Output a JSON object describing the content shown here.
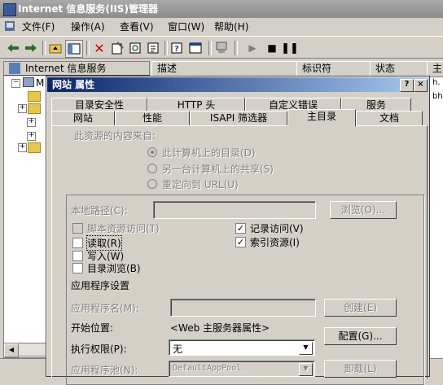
{
  "window": {
    "title": "Internet 信息服务(IIS)管理器"
  },
  "menu": {
    "items": [
      "文件(F)",
      "操作(A)",
      "查看(V)",
      "窗口(W)",
      "帮助(H)"
    ]
  },
  "tree": {
    "root_label": "Internet 信息服务",
    "node_m": "M"
  },
  "list": {
    "columns": [
      "描述",
      "标识符",
      "状态",
      "主"
    ],
    "partial_text": [
      "h.",
      "bh"
    ]
  },
  "dialog": {
    "title": "网站 属性",
    "help": "?",
    "close": "×",
    "tabs_row1": [
      "目录安全性",
      "HTTP 头",
      "自定义错误",
      "服务"
    ],
    "tabs_row2": [
      "网站",
      "性能",
      "ISAPI 筛选器",
      "主目录",
      "文档"
    ],
    "source_label": "此资源的内容来自:",
    "radio_local": "此计算机上的目录(D)",
    "radio_share": "另一台计算机上的共享(S)",
    "radio_redirect": "重定向到 URL(U)",
    "local_path_label": "本地路径(C):",
    "browse": "浏览(O)...",
    "chk_script": "脚本资源访问(T)",
    "chk_read": "读取(R)",
    "chk_write": "写入(W)",
    "chk_dirbrowse": "目录浏览(B)",
    "chk_log": "记录访问(V)",
    "chk_index": "索引资源(I)",
    "check": "✓",
    "app_settings": "应用程序设置",
    "app_name_label": "应用程序名(M):",
    "create": "创建(E)",
    "start_label": "开始位置:",
    "start_value": "<Web 主服务器属性>",
    "config": "配置(G)...",
    "exec_label": "执行权限(P):",
    "exec_value": "无",
    "pool_label": "应用程序池(N):",
    "pool_value": "DefaultAppPool",
    "unload": "卸载(L)"
  }
}
